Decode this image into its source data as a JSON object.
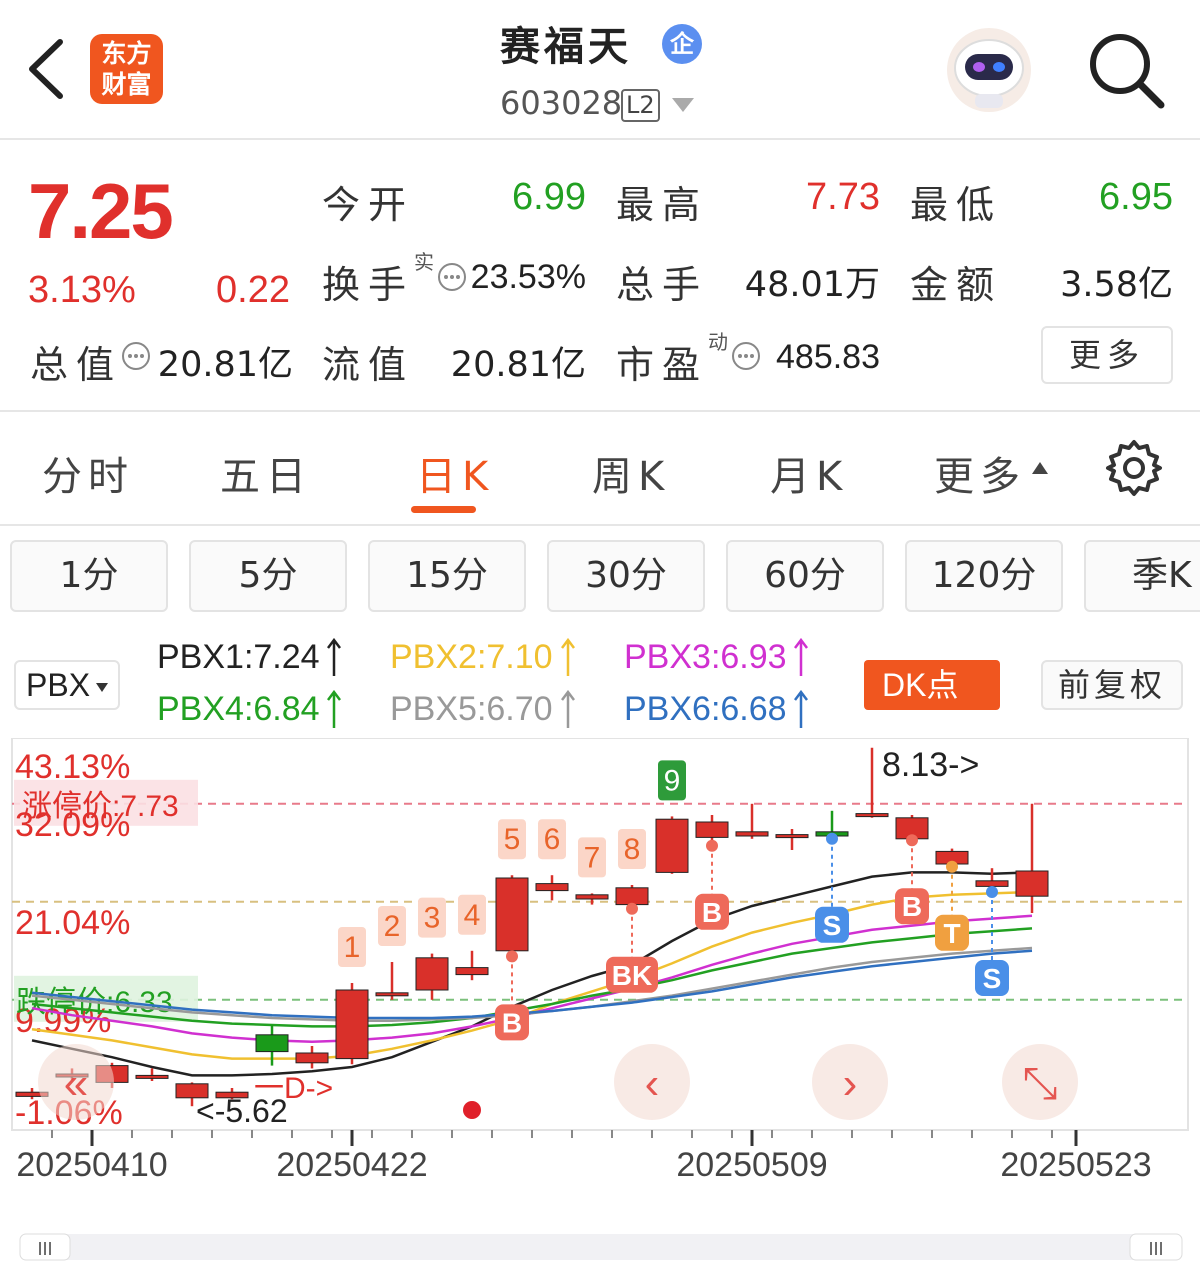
{
  "header": {
    "logo_line1": "东方",
    "logo_line2": "财富",
    "stock_name": "赛福天",
    "ent_badge": "企",
    "stock_code": "603028",
    "level": "L2"
  },
  "quote": {
    "price": "7.25",
    "change_pct": "3.13%",
    "change_val": "0.22",
    "open_label": "今开",
    "open": "6.99",
    "high_label": "最高",
    "high": "7.73",
    "low_label": "最低",
    "low": "6.95",
    "turnover_label": "换手",
    "turnover_sup": "实",
    "turnover": "23.53%",
    "volume_label": "总手",
    "volume": "48.01万",
    "amount_label": "金额",
    "amount": "3.58亿",
    "mktcap_label": "总值",
    "mktcap": "20.81亿",
    "float_label": "流值",
    "float": "20.81亿",
    "pe_label": "市盈",
    "pe_sup": "动",
    "pe": "485.83",
    "more_label": "更多"
  },
  "tabs": [
    {
      "label": "分时"
    },
    {
      "label": "五日"
    },
    {
      "label": "日K"
    },
    {
      "label": "周K"
    },
    {
      "label": "月K"
    },
    {
      "label": "更多"
    }
  ],
  "periods": [
    {
      "label": "1分"
    },
    {
      "label": "5分"
    },
    {
      "label": "15分"
    },
    {
      "label": "30分"
    },
    {
      "label": "60分"
    },
    {
      "label": "120分"
    },
    {
      "label": "季K"
    }
  ],
  "indicator": {
    "selected": "PBX",
    "lines": [
      {
        "text": "PBX1:7.24",
        "color": "#222222"
      },
      {
        "text": "PBX2:7.10",
        "color": "#f0c030"
      },
      {
        "text": "PBX3:6.93",
        "color": "#d030d0"
      },
      {
        "text": "PBX4:6.84",
        "color": "#22a022"
      },
      {
        "text": "PBX5:6.70",
        "color": "#999999"
      },
      {
        "text": "PBX6:6.68",
        "color": "#3070c0"
      }
    ],
    "dk_label": "DK点",
    "adjust_label": "前复权"
  },
  "chart_data": {
    "type": "candlestick",
    "ylim": [
      5.4,
      8.2
    ],
    "y_axis_labels": [
      "43.13%",
      "32.09%",
      "21.04%",
      "9.99%",
      "-1.06%"
    ],
    "limit_up_label": "涨停价:7.73",
    "limit_down_label": "跌停价:6.33",
    "x_tick_labels": [
      "20250410",
      "20250422",
      "20250509",
      "20250523"
    ],
    "max_annotation": "8.13->",
    "min_annotation": "<-5.62",
    "reference_level": 7.03,
    "candles": [
      {
        "o": 5.64,
        "c": 5.67,
        "h": 5.7,
        "l": 5.62
      },
      {
        "o": 5.8,
        "c": 5.8,
        "h": 5.84,
        "l": 5.76
      },
      {
        "o": 5.74,
        "c": 5.86,
        "h": 5.88,
        "l": 5.7
      },
      {
        "o": 5.79,
        "c": 5.79,
        "h": 5.84,
        "l": 5.75
      },
      {
        "o": 5.63,
        "c": 5.73,
        "h": 5.74,
        "l": 5.57
      },
      {
        "o": 5.63,
        "c": 5.67,
        "h": 5.7,
        "l": 5.62
      },
      {
        "o": 6.08,
        "c": 5.96,
        "h": 6.15,
        "l": 5.86
      },
      {
        "o": 5.88,
        "c": 5.95,
        "h": 6.0,
        "l": 5.84
      },
      {
        "o": 5.91,
        "c": 6.4,
        "h": 6.45,
        "l": 5.87
      },
      {
        "o": 6.38,
        "c": 6.38,
        "h": 6.6,
        "l": 6.33
      },
      {
        "o": 6.4,
        "c": 6.63,
        "h": 6.66,
        "l": 6.33
      },
      {
        "o": 6.51,
        "c": 6.56,
        "h": 6.68,
        "l": 6.47
      },
      {
        "o": 6.68,
        "c": 7.2,
        "h": 7.22,
        "l": 6.64
      },
      {
        "o": 7.11,
        "c": 7.16,
        "h": 7.22,
        "l": 7.04
      },
      {
        "o": 7.05,
        "c": 7.08,
        "h": 7.09,
        "l": 7.01
      },
      {
        "o": 7.01,
        "c": 7.13,
        "h": 7.15,
        "l": 6.98
      },
      {
        "o": 7.24,
        "c": 7.62,
        "h": 7.64,
        "l": 7.23
      },
      {
        "o": 7.49,
        "c": 7.6,
        "h": 7.65,
        "l": 7.43
      },
      {
        "o": 7.5,
        "c": 7.53,
        "h": 7.73,
        "l": 7.48
      },
      {
        "o": 7.5,
        "c": 7.51,
        "h": 7.55,
        "l": 7.4
      },
      {
        "o": 7.53,
        "c": 7.5,
        "h": 7.68,
        "l": 7.48
      },
      {
        "o": 7.65,
        "c": 7.66,
        "h": 8.13,
        "l": 7.63
      },
      {
        "o": 7.48,
        "c": 7.63,
        "h": 7.65,
        "l": 7.47
      },
      {
        "o": 7.3,
        "c": 7.39,
        "h": 7.41,
        "l": 7.28
      },
      {
        "o": 7.14,
        "c": 7.18,
        "h": 7.27,
        "l": 7.1
      },
      {
        "o": 7.07,
        "c": 7.25,
        "h": 7.73,
        "l": 6.95
      }
    ],
    "series": [
      {
        "name": "PBX1",
        "color": "#222222",
        "values": [
          6.04,
          5.98,
          5.92,
          5.85,
          5.79,
          5.79,
          5.8,
          5.82,
          5.85,
          5.92,
          6.03,
          6.14,
          6.28,
          6.4,
          6.5,
          6.58,
          6.75,
          6.9,
          7.0,
          7.07,
          7.14,
          7.21,
          7.24,
          7.24,
          7.23,
          7.24
        ]
      },
      {
        "name": "PBX2",
        "color": "#f0c030",
        "values": [
          6.12,
          6.08,
          6.04,
          5.99,
          5.94,
          5.91,
          5.91,
          5.91,
          5.93,
          5.98,
          6.04,
          6.11,
          6.19,
          6.3,
          6.39,
          6.48,
          6.59,
          6.71,
          6.81,
          6.88,
          6.94,
          7.01,
          7.06,
          7.08,
          7.09,
          7.1
        ]
      },
      {
        "name": "PBX3",
        "color": "#d030d0",
        "values": [
          6.27,
          6.22,
          6.18,
          6.14,
          6.09,
          6.06,
          6.04,
          6.03,
          6.04,
          6.06,
          6.09,
          6.14,
          6.2,
          6.27,
          6.34,
          6.41,
          6.49,
          6.58,
          6.66,
          6.73,
          6.78,
          6.83,
          6.86,
          6.89,
          6.91,
          6.93
        ]
      },
      {
        "name": "PBX4",
        "color": "#22a022",
        "values": [
          6.3,
          6.27,
          6.24,
          6.21,
          6.18,
          6.16,
          6.15,
          6.14,
          6.14,
          6.15,
          6.17,
          6.2,
          6.25,
          6.3,
          6.36,
          6.41,
          6.47,
          6.54,
          6.6,
          6.66,
          6.7,
          6.74,
          6.77,
          6.8,
          6.82,
          6.84
        ]
      },
      {
        "name": "PBX5",
        "color": "#999999",
        "values": [
          6.36,
          6.33,
          6.3,
          6.27,
          6.24,
          6.22,
          6.2,
          6.19,
          6.18,
          6.18,
          6.19,
          6.2,
          6.22,
          6.25,
          6.28,
          6.32,
          6.36,
          6.41,
          6.46,
          6.51,
          6.56,
          6.6,
          6.63,
          6.66,
          6.68,
          6.7
        ]
      },
      {
        "name": "PBX6",
        "color": "#3070c0",
        "values": [
          6.38,
          6.35,
          6.32,
          6.29,
          6.26,
          6.24,
          6.22,
          6.21,
          6.2,
          6.2,
          6.2,
          6.21,
          6.23,
          6.25,
          6.28,
          6.31,
          6.35,
          6.39,
          6.44,
          6.49,
          6.53,
          6.57,
          6.6,
          6.63,
          6.66,
          6.68
        ]
      }
    ],
    "markers": [
      {
        "i": 8,
        "label": "1"
      },
      {
        "i": 9,
        "label": "2"
      },
      {
        "i": 10,
        "label": "3"
      },
      {
        "i": 11,
        "label": "4"
      },
      {
        "i": 12,
        "label": "5"
      },
      {
        "i": 13,
        "label": "6"
      },
      {
        "i": 14,
        "label": "7"
      },
      {
        "i": 15,
        "label": "8"
      },
      {
        "i": 16,
        "label": "9"
      }
    ],
    "signals": [
      {
        "i": 12,
        "label": "B"
      },
      {
        "i": 15,
        "label": "BK"
      },
      {
        "i": 17,
        "label": "B"
      },
      {
        "i": 20,
        "label": "S"
      },
      {
        "i": 22,
        "label": "B"
      },
      {
        "i": 23,
        "label": "T"
      },
      {
        "i": 24,
        "label": "S"
      }
    ],
    "overlay_text": "一D->"
  }
}
